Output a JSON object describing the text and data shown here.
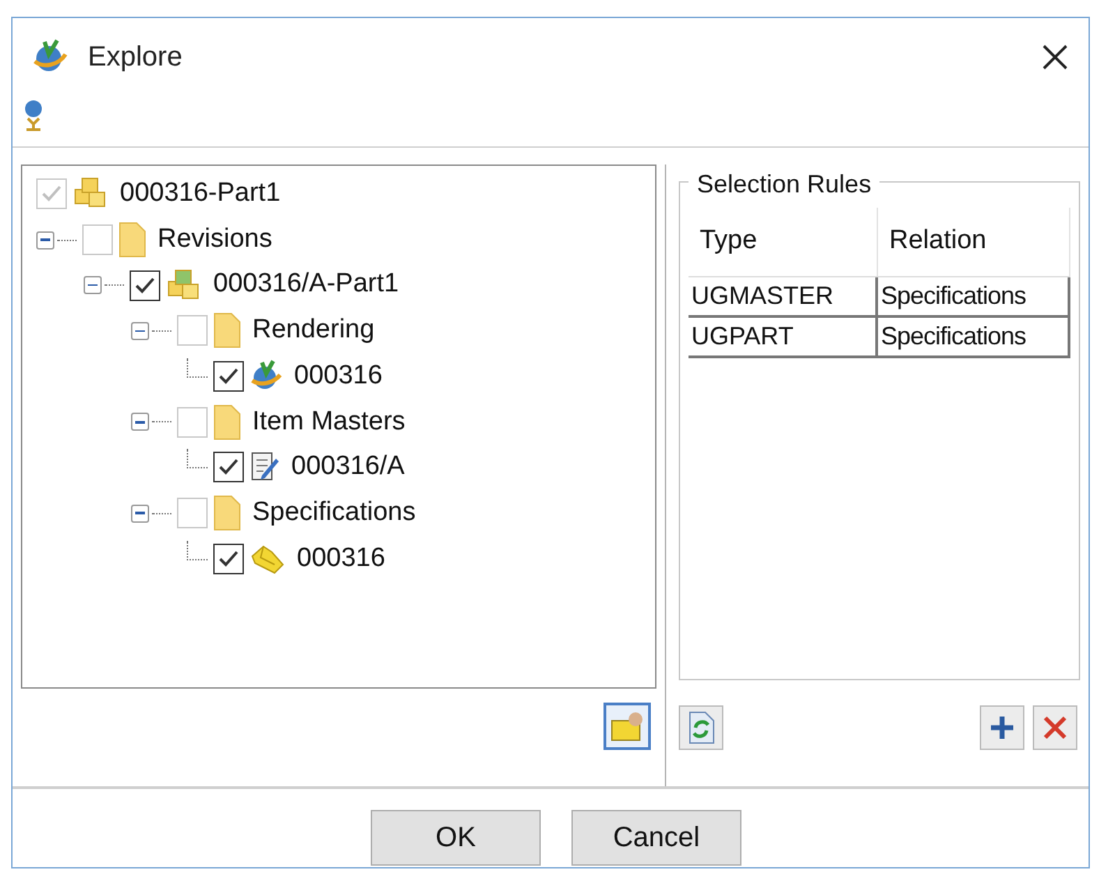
{
  "window": {
    "title": "Explore"
  },
  "tree": [
    {
      "label": "000316-Part1",
      "kind": "part",
      "checked": true,
      "disabled": true,
      "children": [
        {
          "label": "Revisions",
          "kind": "folder",
          "checked": false,
          "disabled": true,
          "expanded": true,
          "children": [
            {
              "label": "000316/A-Part1",
              "kind": "revision",
              "checked": true,
              "disabled": false,
              "expanded": true,
              "children": [
                {
                  "label": "Rendering",
                  "kind": "folder",
                  "checked": false,
                  "disabled": true,
                  "expanded": true,
                  "children": [
                    {
                      "label": "000316",
                      "kind": "rendering",
                      "checked": true,
                      "disabled": false
                    }
                  ]
                },
                {
                  "label": "Item Masters",
                  "kind": "folder",
                  "checked": false,
                  "disabled": true,
                  "expanded": true,
                  "children": [
                    {
                      "label": "000316/A",
                      "kind": "form",
                      "checked": true,
                      "disabled": false
                    }
                  ]
                },
                {
                  "label": "Specifications",
                  "kind": "folder",
                  "checked": false,
                  "disabled": true,
                  "expanded": true,
                  "children": [
                    {
                      "label": "000316",
                      "kind": "dataset",
                      "checked": true,
                      "disabled": false
                    }
                  ]
                }
              ]
            }
          ]
        }
      ]
    }
  ],
  "selection_rules": {
    "title": "Selection Rules",
    "columns": [
      "Type",
      "Relation"
    ],
    "rows": [
      [
        "UGMASTER",
        "Specifications"
      ],
      [
        "UGPART",
        "Specifications"
      ]
    ]
  },
  "buttons": [
    "OK",
    "Cancel"
  ]
}
